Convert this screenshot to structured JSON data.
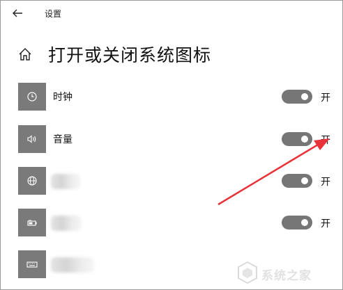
{
  "window": {
    "title": "设置"
  },
  "page": {
    "title": "打开或关闭系统图标"
  },
  "items": [
    {
      "label": "时钟",
      "icon": "clock-icon",
      "state": "开",
      "on": true
    },
    {
      "label": "音量",
      "icon": "volume-icon",
      "state": "开",
      "on": true
    },
    {
      "label": "",
      "icon": "network-globe-icon",
      "state": "开",
      "on": true
    },
    {
      "label": "",
      "icon": "battery-icon",
      "state": "开",
      "on": true
    },
    {
      "label": "",
      "icon": "keyboard-icon",
      "state": "",
      "on": null
    }
  ],
  "watermark": {
    "text": "系统之家"
  },
  "colors": {
    "icon_tile": "#7a7a7a",
    "toggle_on": "#767676",
    "arrow": "#e8333a"
  }
}
